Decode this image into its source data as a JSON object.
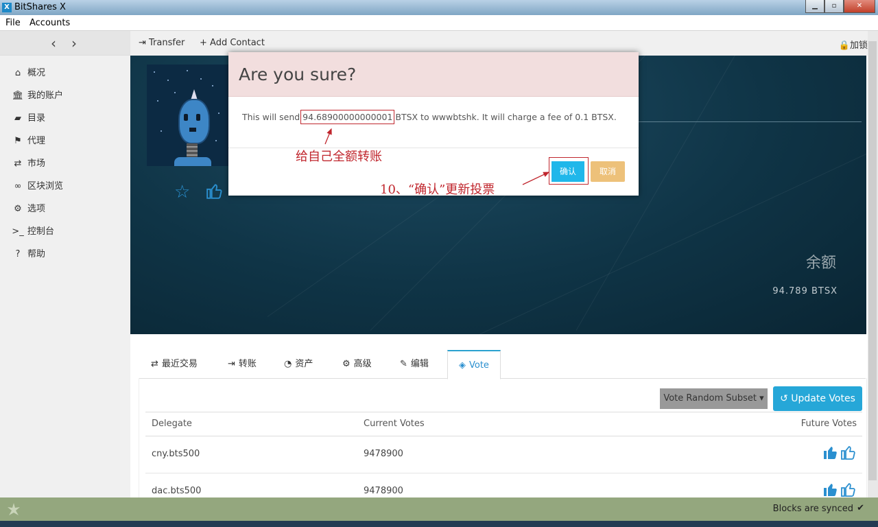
{
  "window": {
    "title": "BitShares X",
    "app_icon": "X"
  },
  "menu": {
    "items": [
      "File",
      "Accounts"
    ]
  },
  "sidebar": {
    "items": [
      {
        "label": "概况",
        "icon": "home-icon"
      },
      {
        "label": "我的账户",
        "icon": "bank-icon"
      },
      {
        "label": "目录",
        "icon": "book-icon"
      },
      {
        "label": "代理",
        "icon": "flag-icon"
      },
      {
        "label": "市场",
        "icon": "exchange-icon"
      },
      {
        "label": "区块浏览",
        "icon": "link-icon"
      },
      {
        "label": "选项",
        "icon": "gears-icon"
      },
      {
        "label": "控制台",
        "icon": "terminal-icon"
      },
      {
        "label": "帮助",
        "icon": "question-icon"
      }
    ]
  },
  "toolbar": {
    "transfer": "Transfer",
    "add_contact": "Add Contact",
    "lock_label": "加锁"
  },
  "banner": {
    "balance_label": "余额",
    "balance_value": "94.789 BTSX"
  },
  "tabs": [
    "最近交易",
    "转账",
    "资产",
    "高级",
    "编辑",
    "Vote"
  ],
  "vote": {
    "random_button": "Vote Random Subset",
    "update_button": "Update Votes",
    "columns": [
      "Delegate",
      "Current Votes",
      "Future Votes"
    ],
    "rows": [
      {
        "delegate": "cny.bts500",
        "votes": "9478900"
      },
      {
        "delegate": "dac.bts500",
        "votes": "9478900"
      }
    ]
  },
  "status": {
    "sync_text": "Blocks are synced"
  },
  "modal": {
    "title": "Are you sure?",
    "msg_prefix": "This will send ",
    "amount": "94.68900000000001",
    "msg_suffix": " BTSX to wwwbtshk. It will charge a fee of 0.1 BTSX.",
    "confirm": "确认",
    "cancel": "取消"
  },
  "annotations": {
    "note_amount": "给自己全额转账",
    "note_confirm": "10、“确认”更新投票"
  },
  "colors": {
    "accent": "#26a7d8",
    "annotation": "#c0262d",
    "modal_header": "#f2dede",
    "status_bar": "#94a77e"
  }
}
